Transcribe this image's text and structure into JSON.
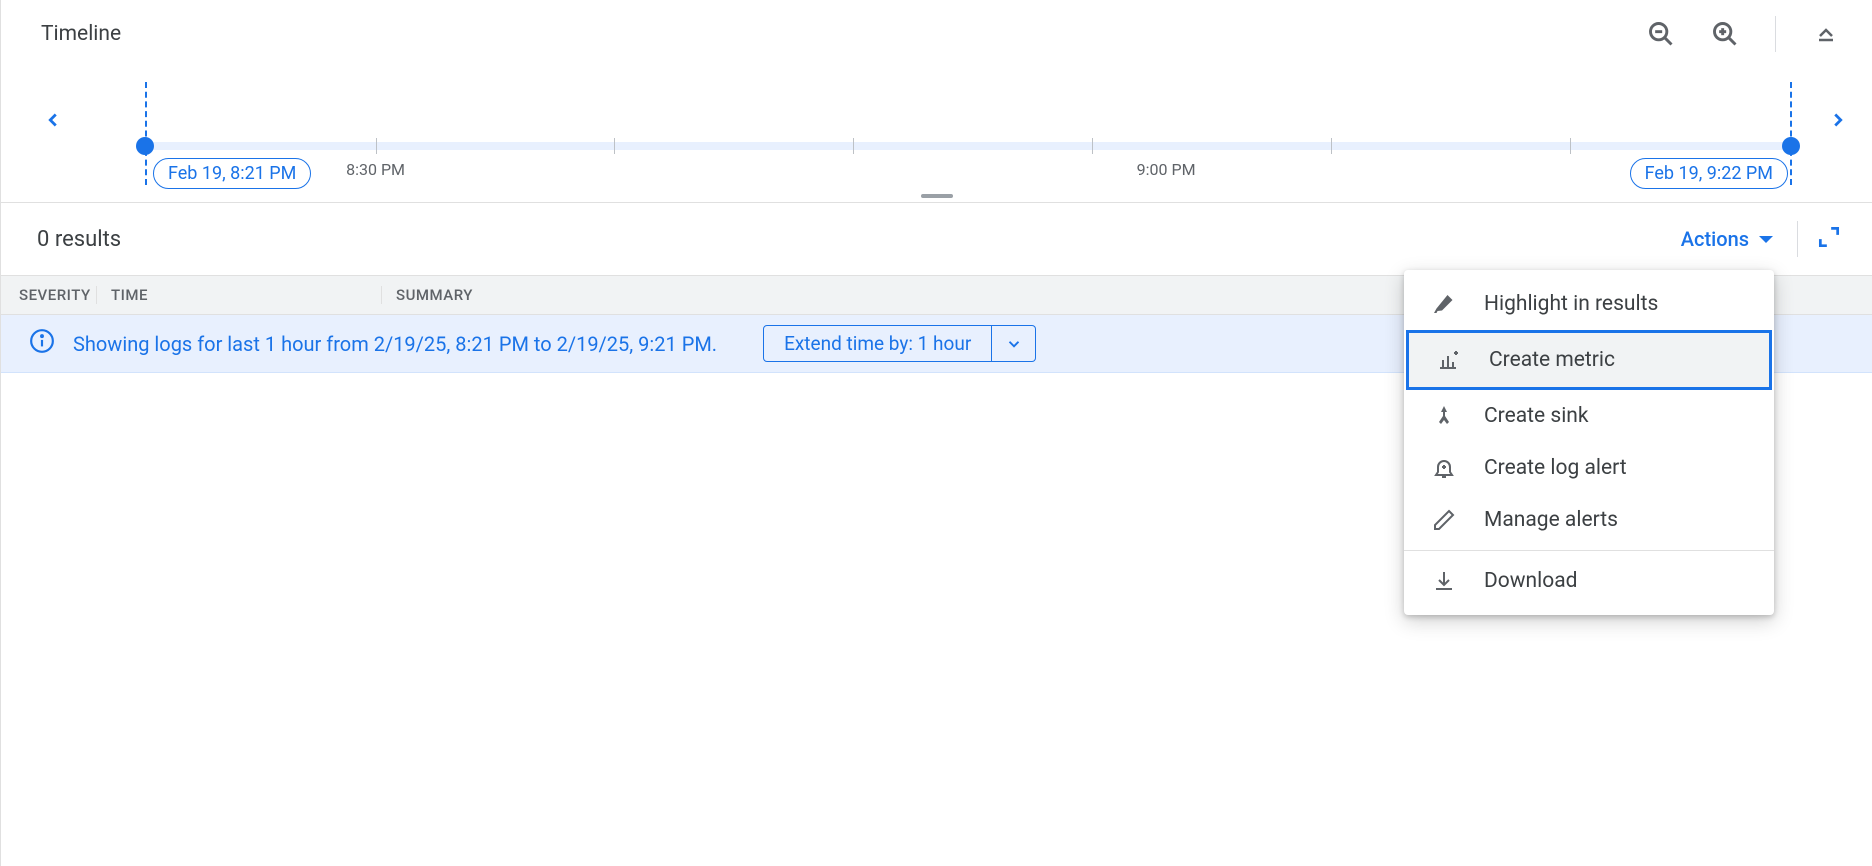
{
  "timeline": {
    "title": "Timeline",
    "start_label": "Feb 19, 8:21 PM",
    "end_label": "Feb 19, 9:22 PM",
    "ticks": [
      {
        "pos": 14,
        "label": "8:30 PM"
      },
      {
        "pos": 28.5,
        "label": ""
      },
      {
        "pos": 43,
        "label": ""
      },
      {
        "pos": 57.5,
        "label": ""
      },
      {
        "pos": 62,
        "label": "9:00 PM",
        "label_only": true
      },
      {
        "pos": 72,
        "label": ""
      },
      {
        "pos": 86.5,
        "label": ""
      }
    ]
  },
  "results": {
    "count_text": "0 results",
    "actions_label": "Actions",
    "columns": {
      "severity": "SEVERITY",
      "time": "TIME",
      "summary": "SUMMARY"
    }
  },
  "info": {
    "text": "Showing logs for last 1 hour from 2/19/25, 8:21 PM to 2/19/25, 9:21 PM.",
    "extend_label": "Extend time by: 1 hour"
  },
  "menu": {
    "items": [
      {
        "icon": "highlighter",
        "label": "Highlight in results"
      },
      {
        "icon": "metric",
        "label": "Create metric",
        "selected": true
      },
      {
        "icon": "sink",
        "label": "Create sink"
      },
      {
        "icon": "alert",
        "label": "Create log alert"
      },
      {
        "icon": "pencil",
        "label": "Manage alerts"
      }
    ],
    "footer": {
      "icon": "download",
      "label": "Download"
    }
  }
}
